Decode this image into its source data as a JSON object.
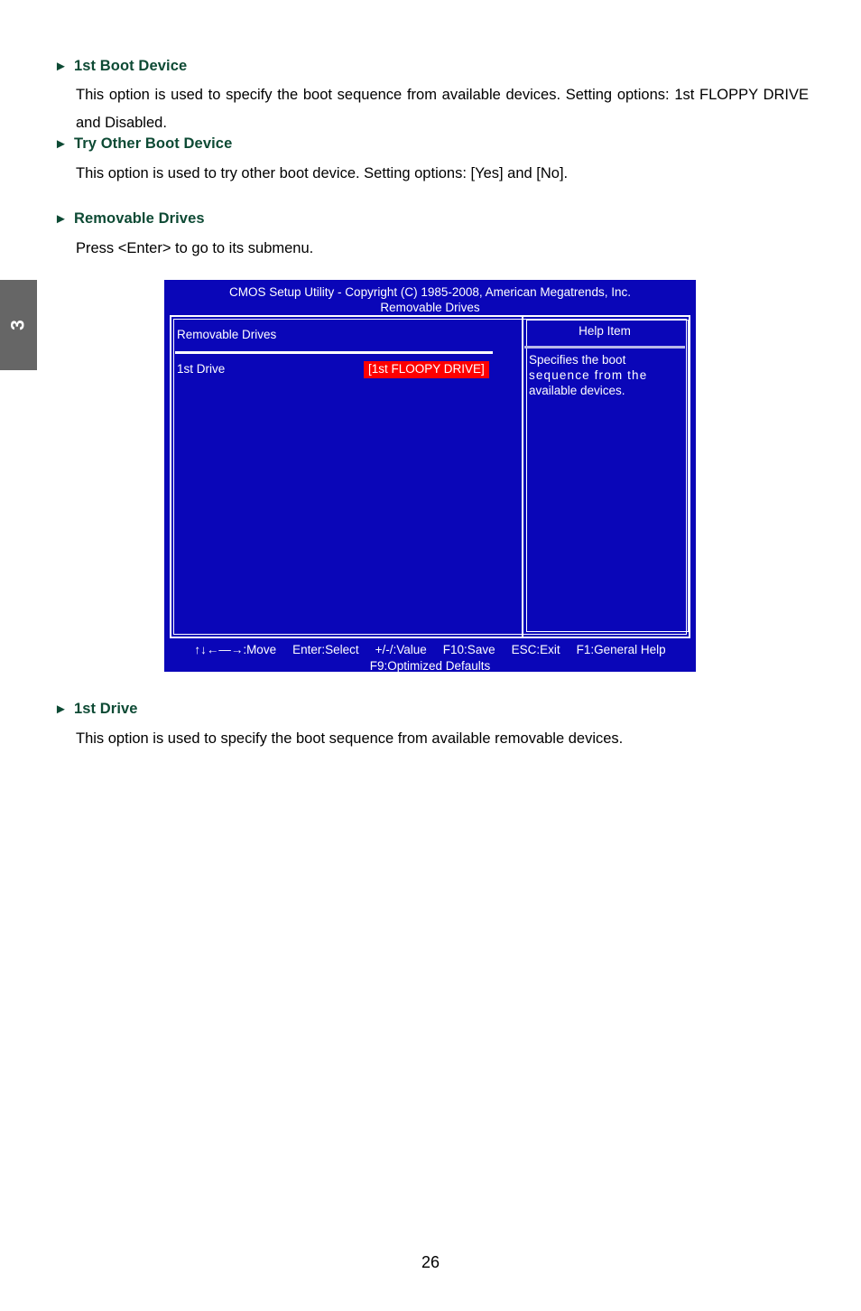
{
  "page": {
    "chapter_tab": "3",
    "page_number": "26"
  },
  "sections": [
    {
      "bullet": "►",
      "heading": "1st Boot Device",
      "body": "This option is used to specify the boot sequence from available devices. Setting options: 1st FLOPPY DRIVE and Disabled."
    },
    {
      "bullet": "►",
      "heading": "Try Other Boot Device",
      "body": "This option is used to try other boot device. Setting options: [Yes] and [No]."
    },
    {
      "bullet": "►",
      "heading": "Removable Drives",
      "body": "Press <Enter> to go to its submenu."
    },
    {
      "bullet": "►",
      "heading": "1st Drive",
      "body": "This option is used to specify the boot sequence from available removable devices."
    }
  ],
  "bios": {
    "title_line1": "CMOS Setup Utility - Copyright (C) 1985-2008, American Megatrends, Inc.",
    "title_line2": "Removable Drives",
    "left_pane": {
      "title": "Removable Drives",
      "rows": [
        {
          "label": "1st Drive",
          "value": "[1st FLOOPY DRIVE]"
        }
      ]
    },
    "help_pane": {
      "title": "Help Item",
      "line1": "Specifies the boot",
      "line2": "sequence from the",
      "line3": "available devices."
    },
    "keys": {
      "move": "↑↓←—→:Move",
      "select": "Enter:Select",
      "value": "+/-/:Value",
      "save": "F10:Save",
      "exit": "ESC:Exit",
      "general_help": "F1:General Help",
      "defaults": "F9:Optimized Defaults"
    },
    "colors": {
      "background": "#0a06b8",
      "highlight": "#fe0000",
      "text": "#ffffff"
    }
  },
  "colors": {
    "heading_green": "#0d4a34",
    "tab_gray": "#666666"
  }
}
